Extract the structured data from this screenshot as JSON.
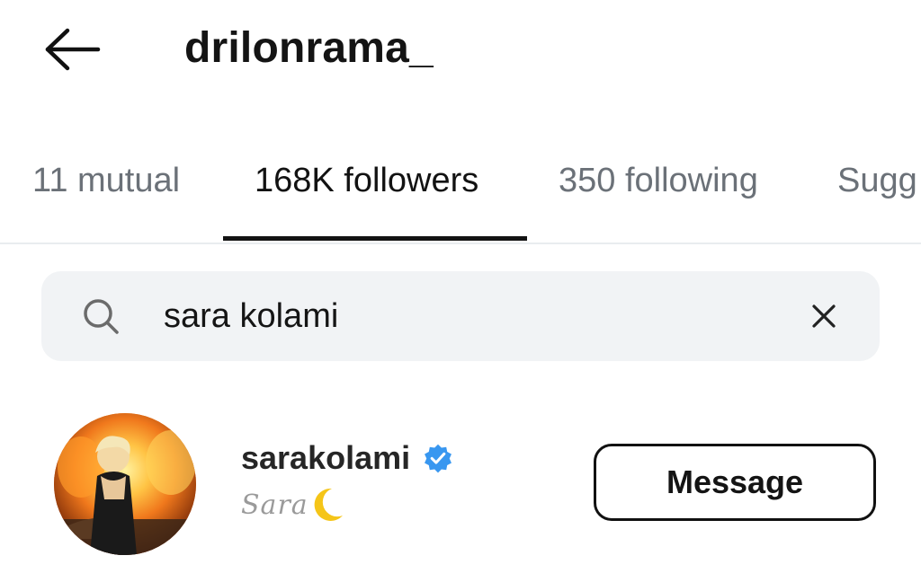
{
  "header": {
    "title": "drilonrama_",
    "back_icon": "arrow-left-icon"
  },
  "tabs": [
    {
      "label": "11 mutual",
      "active": false
    },
    {
      "label": "168K followers",
      "active": true
    },
    {
      "label": "350 following",
      "active": false
    },
    {
      "label": "Sugg",
      "active": false
    }
  ],
  "search": {
    "value": "sara kolami",
    "icon": "search-icon",
    "clear_icon": "close-icon"
  },
  "results": [
    {
      "username": "sarakolami",
      "verified": true,
      "subtitle": "Sara",
      "subtitle_icon": "crescent-moon-icon",
      "button_label": "Message"
    }
  ],
  "colors": {
    "verified_blue": "#3897f0",
    "moon_yellow": "#f5c518",
    "tab_inactive": "#6b7178",
    "search_bg": "#f1f3f5"
  }
}
